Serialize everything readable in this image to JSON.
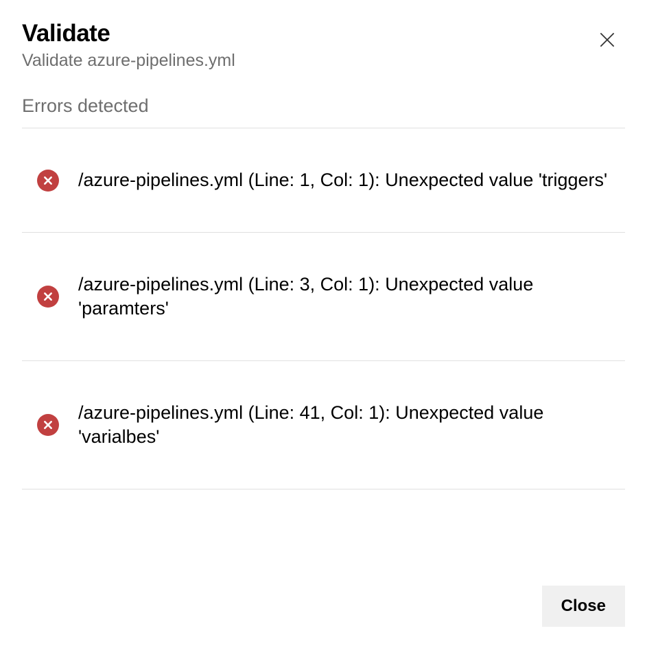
{
  "header": {
    "title": "Validate",
    "subtitle": "Validate azure-pipelines.yml"
  },
  "status_label": "Errors detected",
  "errors": [
    {
      "message": "/azure-pipelines.yml (Line: 1, Col: 1): Unexpected value 'triggers'"
    },
    {
      "message": "/azure-pipelines.yml (Line: 3, Col: 1): Unexpected value 'paramters'"
    },
    {
      "message": "/azure-pipelines.yml (Line: 41, Col: 1): Unexpected value 'varialbes'"
    }
  ],
  "footer": {
    "close_label": "Close"
  }
}
